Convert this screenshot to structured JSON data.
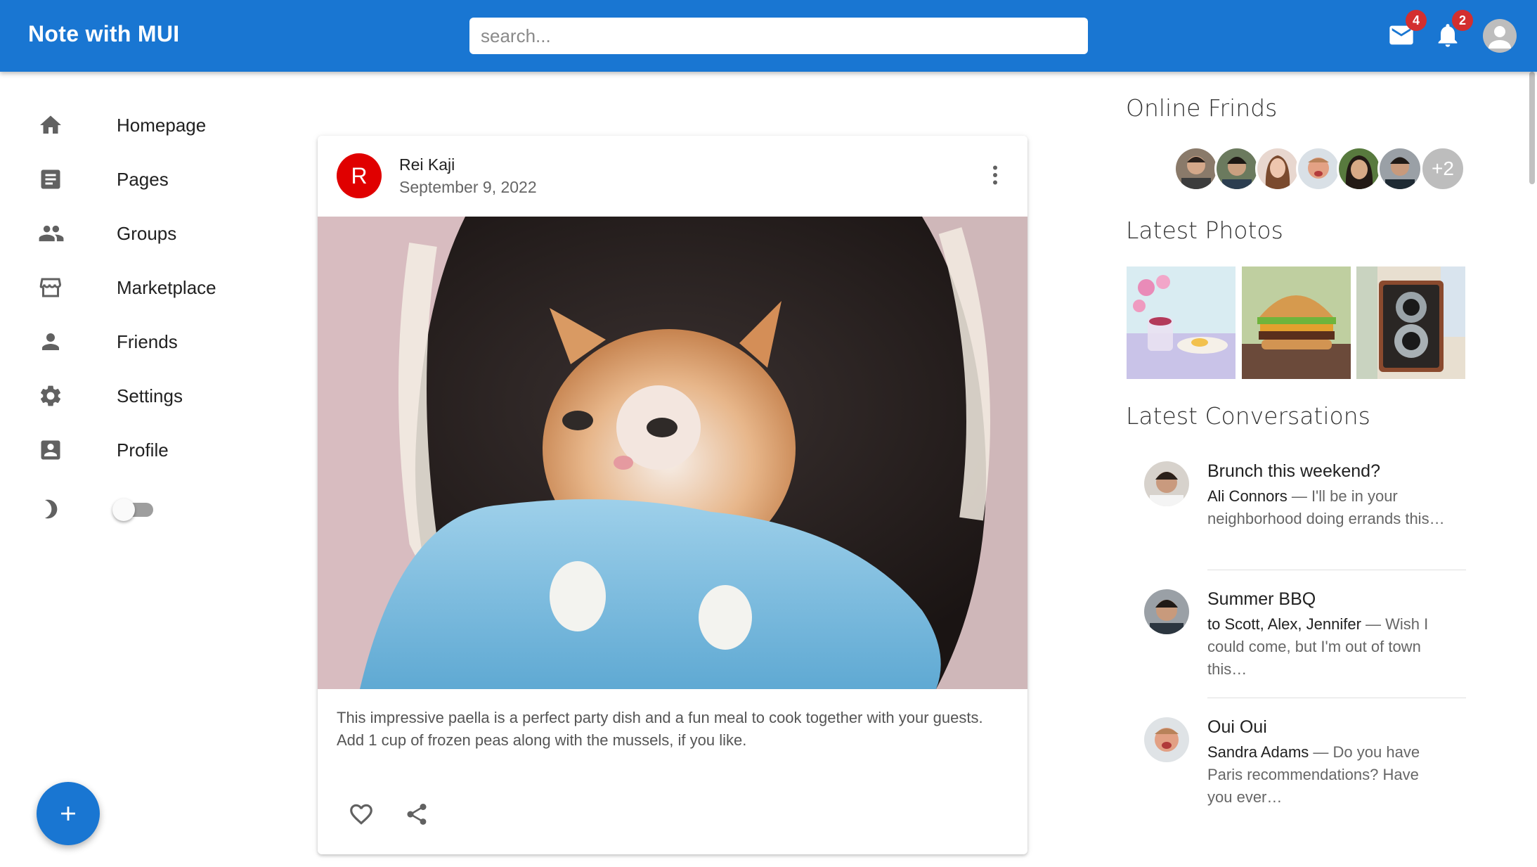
{
  "app": {
    "title": "Note with MUI"
  },
  "search": {
    "placeholder": "search..."
  },
  "header": {
    "mail_badge": "4",
    "notifications_badge": "2",
    "icons": [
      "mail-icon",
      "bell-icon",
      "account-icon"
    ]
  },
  "sidebar": {
    "items": [
      {
        "label": "Homepage",
        "icon": "home-icon"
      },
      {
        "label": "Pages",
        "icon": "article-icon"
      },
      {
        "label": "Groups",
        "icon": "group-icon"
      },
      {
        "label": "Marketplace",
        "icon": "storefront-icon"
      },
      {
        "label": "Friends",
        "icon": "person-icon"
      },
      {
        "label": "Settings",
        "icon": "settings-icon"
      },
      {
        "label": "Profile",
        "icon": "account-box-icon"
      }
    ],
    "dark_mode": {
      "icon": "moon-icon",
      "enabled": false
    }
  },
  "fab": {
    "label": "+"
  },
  "post": {
    "avatar_letter": "R",
    "author": "Rei Kaji",
    "date": "September 9, 2022",
    "image": "kitten-photo",
    "text": "This impressive paella is a perfect party dish and a fun meal to cook together with your guests. Add 1 cup of frozen peas along with the mussels, if you like.",
    "actions": [
      "favorite-icon",
      "share-icon"
    ]
  },
  "rightbar": {
    "online_title": "Online Frinds",
    "online_more": "+2",
    "photos_title": "Latest Photos",
    "photos": [
      "flowers-breakfast-photo",
      "burger-photo",
      "camera-photo"
    ],
    "conversations_title": "Latest Conversations",
    "conversations": [
      {
        "title": "Brunch this weekend?",
        "who": "Ali Connors",
        "text": " — I'll be in your neighborhood doing errands this…"
      },
      {
        "title": "Summer BBQ",
        "who": "to Scott, Alex, Jennifer",
        "text": " — Wish I could come, but I'm out of town this…"
      },
      {
        "title": "Oui Oui",
        "who": "Sandra Adams",
        "text": " — Do you have Paris recommendations? Have you ever…"
      }
    ]
  },
  "colors": {
    "primary": "#1976d2",
    "badge": "#d32f2f",
    "avatar_red": "#e00000"
  }
}
